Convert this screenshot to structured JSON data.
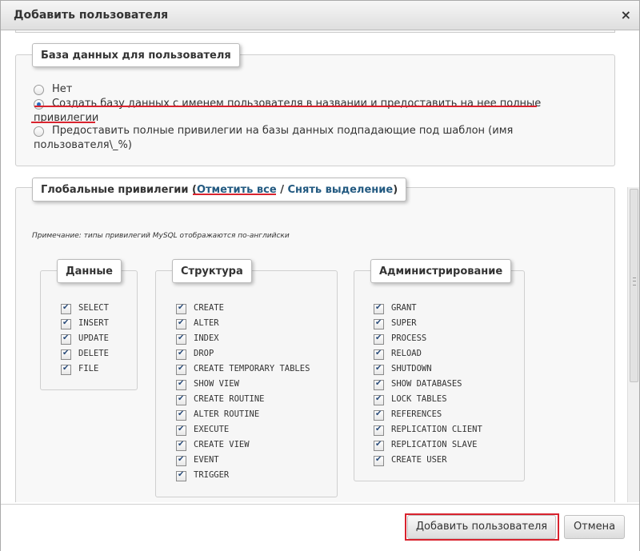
{
  "dialog": {
    "title": "Добавить пользователя",
    "close_icon": "×"
  },
  "database_section": {
    "legend": "База данных для пользователя",
    "options": [
      {
        "label": "Нет",
        "checked": false
      },
      {
        "label": "Создать базу данных с именем пользователя в названии и предоставить на нее полные привилегии",
        "checked": true
      },
      {
        "label": "Предоставить полные привилегии на базы данных подпадающие под шаблон (имя пользователя\\_%)",
        "checked": false
      }
    ]
  },
  "global_section": {
    "legend_prefix": "Глобальные привилегии (",
    "check_all": "Отметить все",
    "separator": " / ",
    "uncheck_all": "Снять выделение",
    "legend_suffix": ")",
    "note": "Примечание: типы привилегий MySQL отображаются по-английски",
    "groups": [
      {
        "title": "Данные",
        "items": [
          "SELECT",
          "INSERT",
          "UPDATE",
          "DELETE",
          "FILE"
        ]
      },
      {
        "title": "Структура",
        "items": [
          "CREATE",
          "ALTER",
          "INDEX",
          "DROP",
          "CREATE TEMPORARY TABLES",
          "SHOW VIEW",
          "CREATE ROUTINE",
          "ALTER ROUTINE",
          "EXECUTE",
          "CREATE VIEW",
          "EVENT",
          "TRIGGER"
        ]
      },
      {
        "title": "Администрирование",
        "items": [
          "GRANT",
          "SUPER",
          "PROCESS",
          "RELOAD",
          "SHUTDOWN",
          "SHOW DATABASES",
          "LOCK TABLES",
          "REFERENCES",
          "REPLICATION CLIENT",
          "REPLICATION SLAVE",
          "CREATE USER"
        ]
      }
    ]
  },
  "footer": {
    "add_button": "Добавить пользователя",
    "cancel_button": "Отмена"
  },
  "colors": {
    "annotation_red": "#d9232e",
    "link_blue": "#235a81",
    "radio_selected": "#2a6bbf"
  }
}
